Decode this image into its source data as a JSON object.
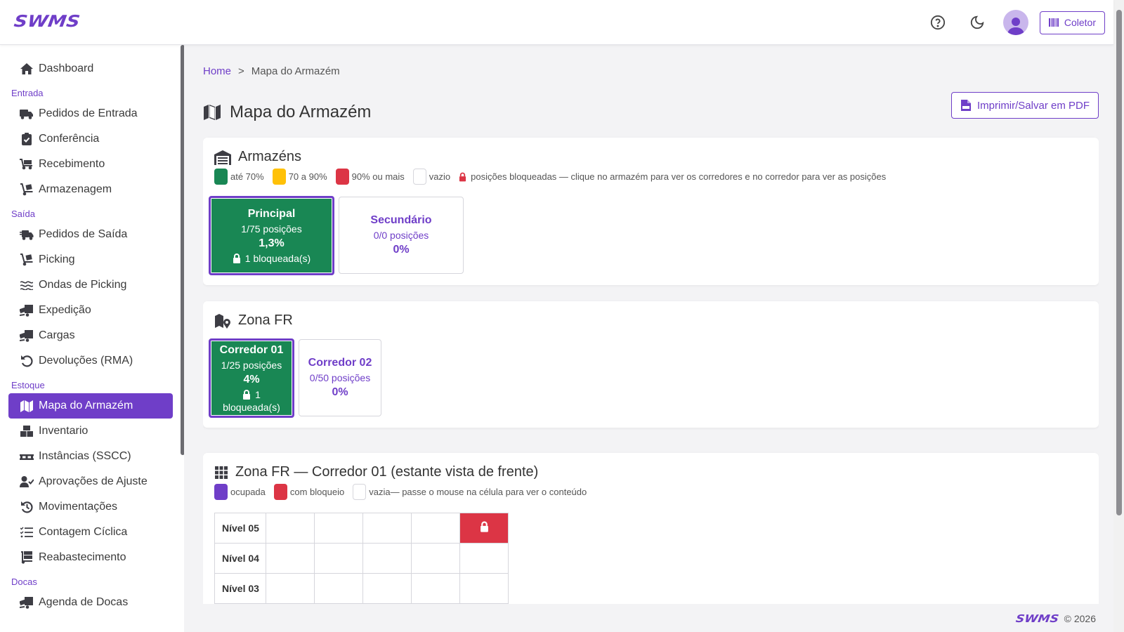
{
  "brand": "SWMS",
  "header": {
    "coletor_label": "Coletor"
  },
  "sidebar": {
    "items": [
      {
        "type": "item",
        "label": "Dashboard",
        "icon": "home-icon"
      },
      {
        "type": "section",
        "label": "Entrada"
      },
      {
        "type": "item",
        "label": "Pedidos de Entrada",
        "icon": "truck-icon"
      },
      {
        "type": "item",
        "label": "Conferência",
        "icon": "clipboard-check-icon"
      },
      {
        "type": "item",
        "label": "Recebimento",
        "icon": "dolly-icon"
      },
      {
        "type": "item",
        "label": "Armazenagem",
        "icon": "dolly-box-icon"
      },
      {
        "type": "section",
        "label": "Saída"
      },
      {
        "type": "item",
        "label": "Pedidos de Saída",
        "icon": "truck-fast-icon"
      },
      {
        "type": "item",
        "label": "Picking",
        "icon": "dolly-box-icon"
      },
      {
        "type": "item",
        "label": "Ondas de Picking",
        "icon": "waves-icon"
      },
      {
        "type": "item",
        "label": "Expedição",
        "icon": "truck-ramp-icon"
      },
      {
        "type": "item",
        "label": "Cargas",
        "icon": "truck-ramp-icon"
      },
      {
        "type": "item",
        "label": "Devoluções (RMA)",
        "icon": "undo-icon"
      },
      {
        "type": "section",
        "label": "Estoque"
      },
      {
        "type": "item",
        "label": "Mapa do Armazém",
        "icon": "map-icon",
        "active": true
      },
      {
        "type": "item",
        "label": "Inventario",
        "icon": "boxes-icon"
      },
      {
        "type": "item",
        "label": "Instâncias (SSCC)",
        "icon": "pallet-icon"
      },
      {
        "type": "item",
        "label": "Aprovações de Ajuste",
        "icon": "user-check-icon"
      },
      {
        "type": "item",
        "label": "Movimentações",
        "icon": "history-icon"
      },
      {
        "type": "item",
        "label": "Contagem Cíclica",
        "icon": "list-check-icon"
      },
      {
        "type": "item",
        "label": "Reabastecimento",
        "icon": "dolly-stack-icon"
      },
      {
        "type": "section",
        "label": "Docas"
      },
      {
        "type": "item",
        "label": "Agenda de Docas",
        "icon": "truck-ramp-icon"
      }
    ]
  },
  "breadcrumb": {
    "home": "Home",
    "separator": ">",
    "current": "Mapa do Armazém"
  },
  "page": {
    "title": "Mapa do Armazém",
    "pdf_button": "Imprimir/Salvar em PDF"
  },
  "warehouses": {
    "title": "Armazéns",
    "legend": [
      {
        "color": "#198754",
        "label": "até 70%"
      },
      {
        "color": "#ffc107",
        "label": "70 a 90%"
      },
      {
        "color": "#dc3545",
        "label": "90% ou mais"
      },
      {
        "color": "#ffffff",
        "label": "vazio"
      }
    ],
    "legend_note": "posições bloqueadas — clique no armazém para ver os corredores e no corredor para ver as posições",
    "tiles": [
      {
        "name": "Principal",
        "positions": "1/75 posições",
        "pct": "1,3%",
        "blocked": "1 bloqueada(s)"
      },
      {
        "name": "Secundário",
        "positions": "0/0 posições",
        "pct": "0%"
      }
    ]
  },
  "zone": {
    "title": "Zona FR",
    "tiles": [
      {
        "name": "Corredor 01",
        "positions": "1/25 posições",
        "pct": "4%",
        "blocked_num": "1",
        "blocked_text": "bloqueada(s)"
      },
      {
        "name": "Corredor 02",
        "positions": "0/50 posições",
        "pct": "0%"
      }
    ]
  },
  "shelf": {
    "title": "Zona FR — Corredor 01 (estante vista de frente)",
    "legend": [
      {
        "color": "#6f3ec8",
        "label": "ocupada"
      },
      {
        "color": "#dc3545",
        "label": "com bloqueio"
      },
      {
        "color": "#ffffff",
        "label": "vazia"
      }
    ],
    "legend_note": " — passe o mouse na célula para ver o conteúdo",
    "levels": [
      {
        "label": "Nível 05",
        "cells": [
          "empty",
          "empty",
          "empty",
          "empty",
          "blocked"
        ]
      },
      {
        "label": "Nível 04",
        "cells": [
          "empty",
          "empty",
          "empty",
          "empty",
          "empty"
        ]
      },
      {
        "label": "Nível 03",
        "cells": [
          "empty",
          "empty",
          "empty",
          "empty",
          "empty"
        ]
      }
    ]
  },
  "footer": {
    "brand": "SWMS",
    "copyright": "© 2026"
  },
  "colors": {
    "accent": "#6f3ec8",
    "green": "#198754",
    "yellow": "#ffc107",
    "red": "#dc3545"
  }
}
